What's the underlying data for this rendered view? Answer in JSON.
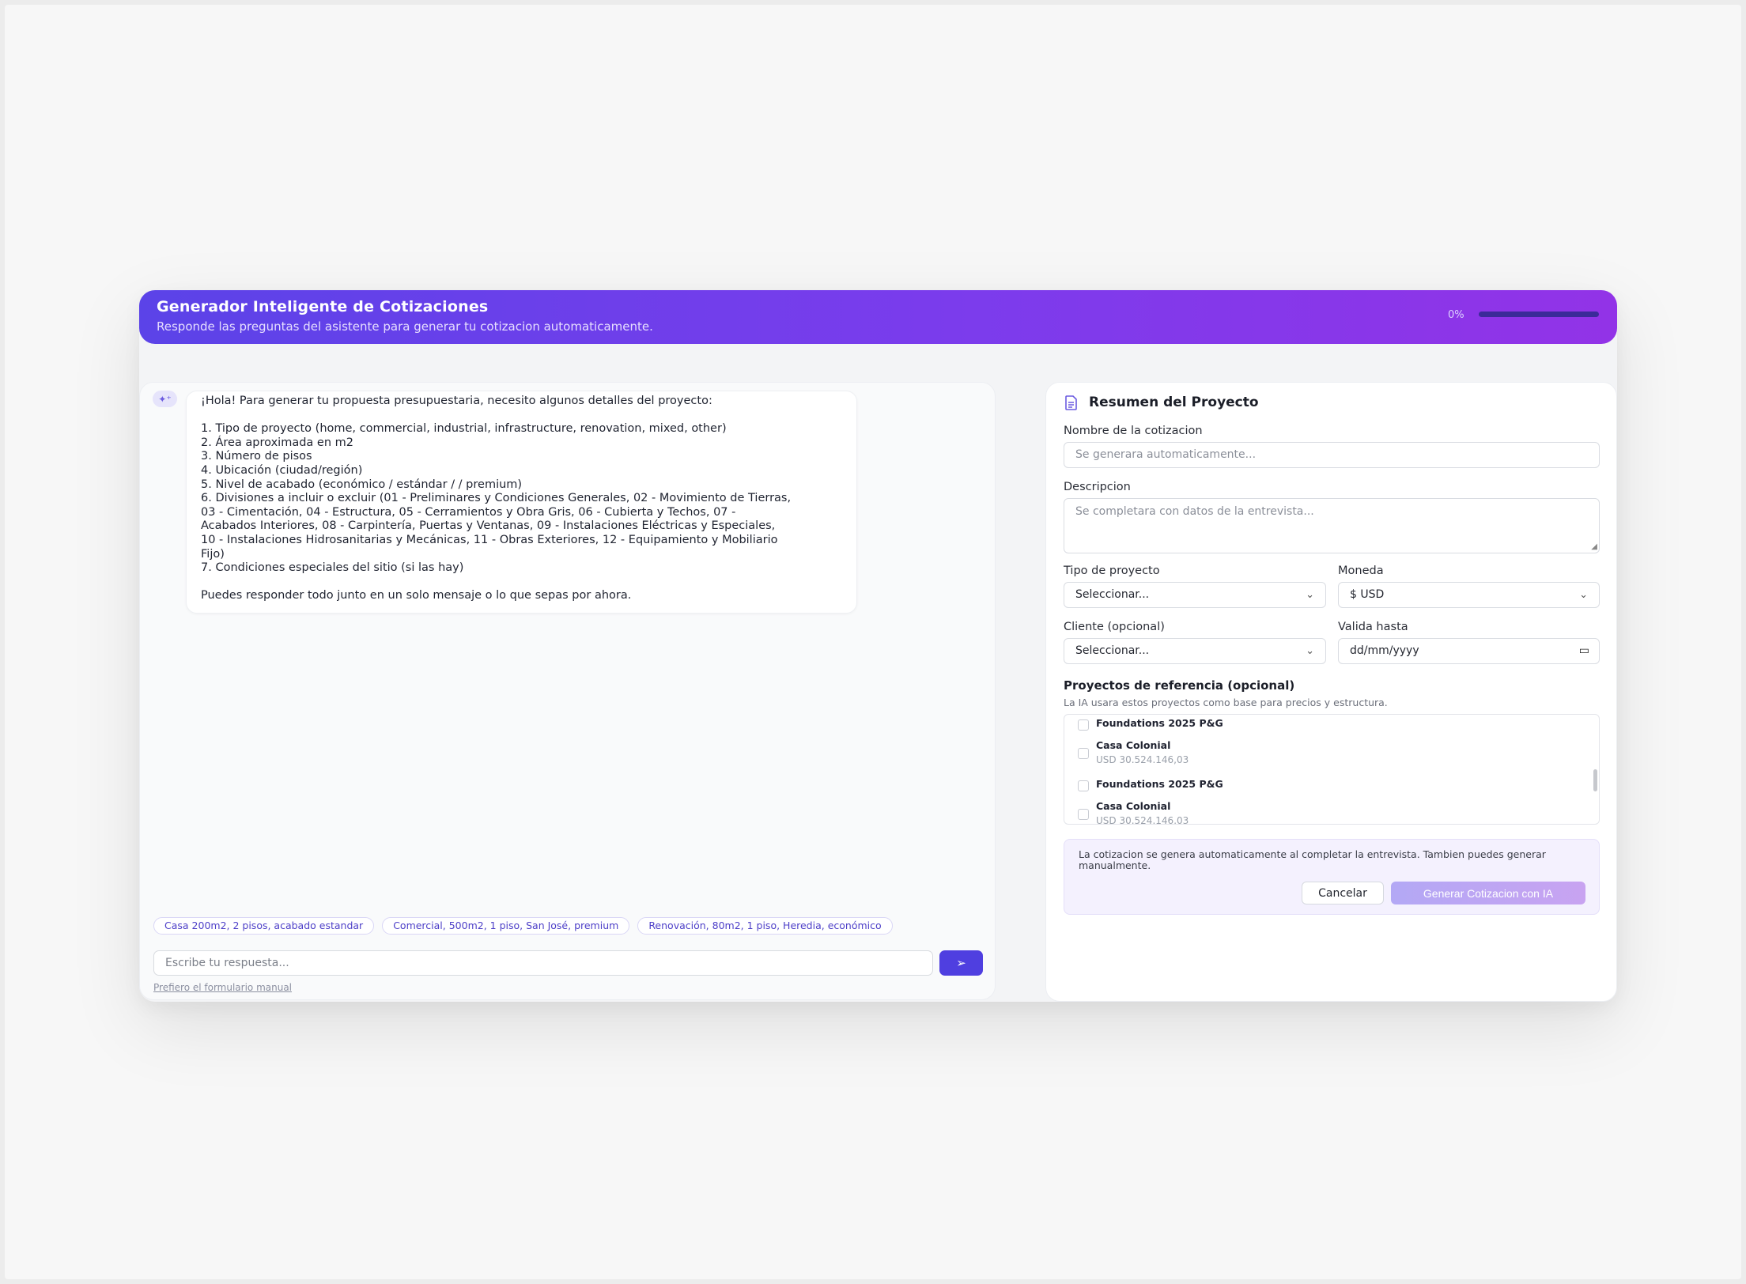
{
  "header": {
    "title": "Generador Inteligente de Cotizaciones",
    "subtitle": "Responde las preguntas del asistente para generar tu cotizacion automaticamente.",
    "progress_label": "0%",
    "progress": 0
  },
  "chat": {
    "message_intro": "¡Hola! Para generar tu propuesta presupuestaria, necesito algunos detalles del proyecto:",
    "message_list": "1. Tipo de proyecto (home, commercial, industrial, infrastructure, renovation, mixed, other)\n2. Área aproximada en m2\n3. Número de pisos\n4. Ubicación (ciudad/región)\n5. Nivel de acabado (económico / estándar / / premium)\n6. Divisiones a incluir o excluir (01 - Preliminares y Condiciones Generales, 02 - Movimiento de Tierras,\n03 - Cimentación, 04 - Estructura, 05 - Cerramientos y Obra Gris, 06 - Cubierta y Techos, 07 -\nAcabados Interiores, 08 - Carpintería, Puertas y Ventanas, 09 - Instalaciones Eléctricas y Especiales,\n10 - Instalaciones Hidrosanitarias y Mecánicas, 11 - Obras Exteriores, 12 - Equipamiento y Mobiliario\nFijo)\n7. Condiciones especiales del sitio (si las hay)",
    "message_outro": "Puedes responder todo junto en un solo mensaje o lo que sepas por ahora.",
    "suggestions": [
      "Casa 200m2, 2 pisos, acabado estandar",
      "Comercial, 500m2, 1 piso, San José, premium",
      "Renovación, 80m2, 1 piso, Heredia, económico"
    ],
    "input_placeholder": "Escribe tu respuesta...",
    "manual_link": "Prefiero el formulario manual"
  },
  "summary": {
    "title": "Resumen del Proyecto",
    "name_label": "Nombre de la cotizacion",
    "name_placeholder": "Se generara automaticamente...",
    "desc_label": "Descripcion",
    "desc_placeholder": "Se completara con datos de la entrevista...",
    "type_label": "Tipo de proyecto",
    "type_value": "Seleccionar...",
    "currency_label": "Moneda",
    "currency_value": "$ USD",
    "client_label": "Cliente (opcional)",
    "client_value": "Seleccionar...",
    "valid_label": "Valida hasta",
    "valid_value": "dd/mm/yyyy",
    "ref_title": "Proyectos de referencia (opcional)",
    "ref_subtitle": "La IA usara estos proyectos como base para precios y estructura.",
    "ref_items": [
      {
        "name": "Foundations 2025 P&G",
        "price": ""
      },
      {
        "name": "Casa Colonial",
        "price": "USD 30.524.146,03"
      },
      {
        "name": "Foundations 2025 P&G",
        "price": ""
      },
      {
        "name": "Casa Colonial",
        "price": "USD 30.524.146,03"
      }
    ],
    "note": "La cotizacion se genera automaticamente al completar la entrevista. Tambien puedes generar manualmente.",
    "cancel_label": "Cancelar",
    "generate_label": "Generar Cotizacion con IA"
  },
  "colors": {
    "accent": "#4f3fe0",
    "header_gradient_start": "#5b43e8",
    "header_gradient_end": "#9233e7"
  },
  "icons": {
    "bot": "sparkle-icon",
    "send": "send-icon",
    "summary": "document-icon",
    "dropdown": "chevron-down-icon",
    "date": "calendar-icon"
  }
}
